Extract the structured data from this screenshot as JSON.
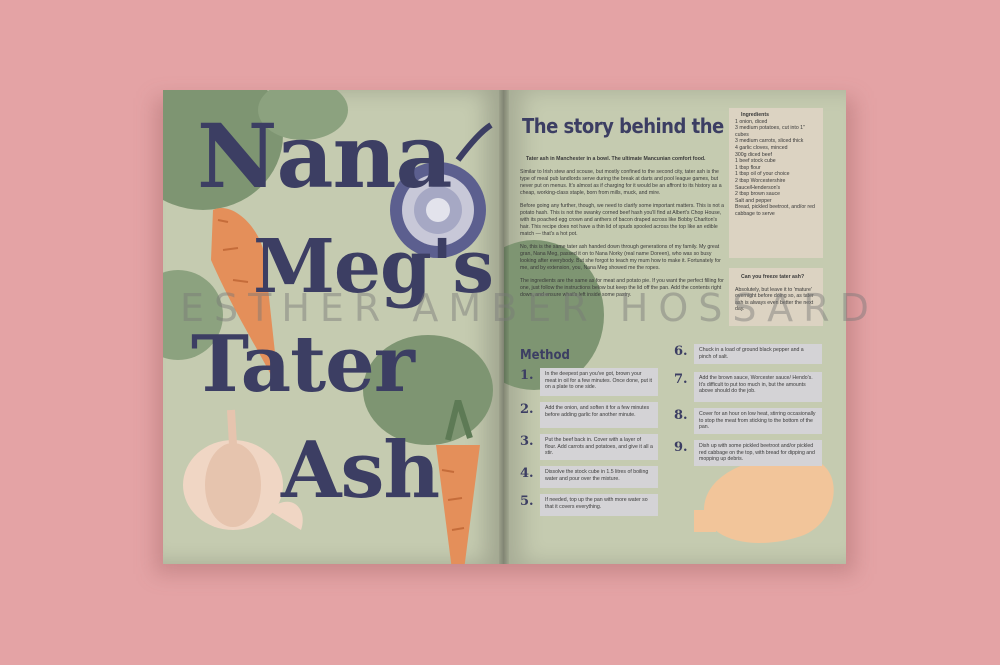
{
  "title": {
    "line1": "Nana",
    "line2": "Meg's",
    "line3": "Tater",
    "line4": "Ash"
  },
  "story": {
    "heading": "The story behind the meal",
    "paragraphs": [
      "Tater ash in Manchester in a bowl. The ultimate Mancunian comfort food.",
      "Similar to Irish stew and scouse, but mostly confined to the second city, tater ash is the type of meal pub landlords serve during the break at darts and pool league games, but never put on menus. It's almost as if charging for it would be an affront to its history as a cheap, working-class staple, born from mills, muck, and mire.",
      "Before going any further, though, we need to clarify some important matters. This is not a potato hash. This is not the swanky corned beef hash you'll find at Albert's Chop House, with its poached egg crown and anthers of bacon draped across like Bobby Charlton's hair. This recipe does not have a thin lid of spuds spooled across the top like an edible match — that's a hot pot.",
      "No, this is the same tater ash handed down through generations of my family. My great gran, Nana Meg, passed it on to Nana Norky (real name Doreen), who was so busy looking after everybody. But she forgot to teach my mum how to make it. Fortunately for me, and by extension, you, Nana Meg showed me the ropes.",
      "The ingredients are the same as for meat and potato pie. If you want the perfect filling for one, just follow the instructions below but keep the lid off the pan. Add the contents right down, and ensure what's left inside some pastry."
    ]
  },
  "ingredients": {
    "heading": "Ingredients",
    "items": [
      "1 onion, diced",
      "3 medium potatoes, cut into 1\" cubes",
      "3 medium carrots, sliced thick",
      "4 garlic cloves, minced",
      "300g diced beef",
      "1 beef stock cube",
      "1 tbsp flour",
      "1 tbsp oil of your choice",
      "2 tbsp Worcestershire Sauce/Henderson's",
      "2 tbsp brown sauce",
      "Salt and pepper",
      "Bread, pickled beetroot, and/or red cabbage to serve"
    ]
  },
  "faq": {
    "question": "Can you freeze tater ash?",
    "answer": "Absolutely, but leave it to 'mature' overnight before doing so, as tater ash is always even better the next day."
  },
  "method": {
    "heading": "Method",
    "steps": [
      {
        "num": "1.",
        "text": "In the deepest pan you've got, brown your meat in oil for a few minutes. Once done, put it on a plate to one side."
      },
      {
        "num": "2.",
        "text": "Add the onion, and soften it for a few minutes before adding garlic for another minute."
      },
      {
        "num": "3.",
        "text": "Put the beef back in. Cover with a layer of flour. Add carrots and potatoes, and give it all a stir."
      },
      {
        "num": "4.",
        "text": "Dissolve the stock cube in 1.5 litres of boiling water and pour over the mixture."
      },
      {
        "num": "5.",
        "text": "If needed, top up the pan with more water so that it covers everything."
      },
      {
        "num": "6.",
        "text": "Chuck in a load of ground black pepper and a pinch of salt."
      },
      {
        "num": "7.",
        "text": "Add the brown sauce, Worcester sauce/ Hendo's. It's difficult to put too much in, but the amounts above should do the job."
      },
      {
        "num": "8.",
        "text": "Cover for an hour on low heat, stirring occasionally to stop the meat from sticking to the bottom of the pan."
      },
      {
        "num": "9.",
        "text": "Dish up with some pickled beetroot and/or pickled red cabbage on the top, with bread for dipping and mopping up debris."
      }
    ]
  },
  "watermark": "ESTHER AMBER HOSSARD",
  "colors": {
    "background": "#e4a3a5",
    "page": "#c5cbb0",
    "title": "#3c3e63",
    "carrot": "#e48f5a",
    "leaf": "#7e9572",
    "box": "#d4d3d6"
  }
}
